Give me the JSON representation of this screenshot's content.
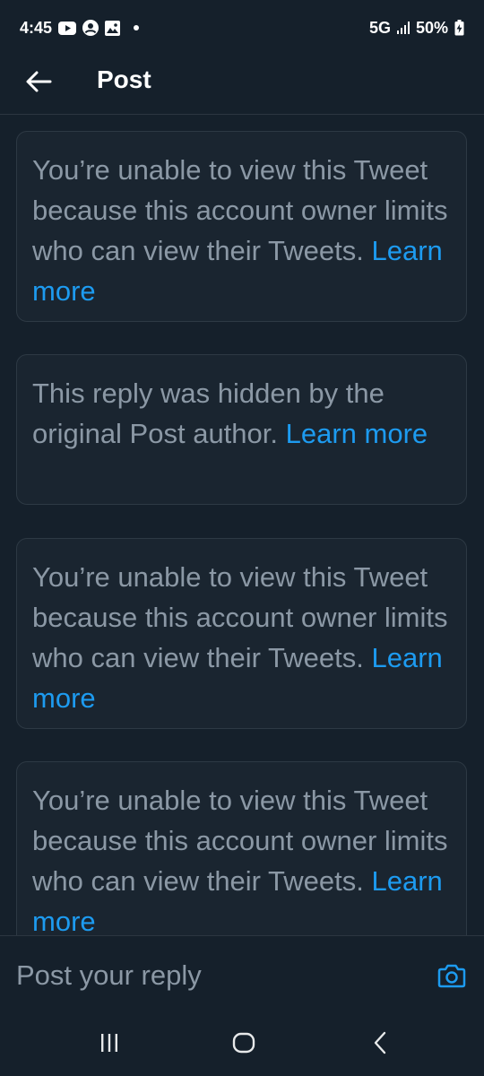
{
  "status_bar": {
    "time": "4:45",
    "network": "5G",
    "battery": "50%",
    "icons": [
      "youtube-icon",
      "account-circle-icon",
      "gallery-icon",
      "notification-dot-icon",
      "signal-icon",
      "battery-charging-icon"
    ]
  },
  "header": {
    "title": "Post",
    "back_icon": "arrow-left-icon"
  },
  "notices": [
    {
      "text": "You’re unable to view this Tweet because this account owner limits who can view their Tweets.",
      "link": "Learn more"
    },
    {
      "text": "This reply was hidden by the original Post author.",
      "link": "Learn more"
    },
    {
      "text": "You’re unable to view this Tweet because this account owner limits who can view their Tweets.",
      "link": "Learn more"
    },
    {
      "text": "You’re unable to view this Tweet because this account owner limits who can view their Tweets.",
      "link": "Learn more"
    }
  ],
  "reply": {
    "placeholder": "Post your reply",
    "value": "",
    "camera_icon": "camera-icon"
  },
  "nav": {
    "icons": [
      "recent-apps-icon",
      "home-icon",
      "back-icon"
    ]
  },
  "colors": {
    "background": "#15202b",
    "card": "#1a2530",
    "muted_text": "#8b98a5",
    "link": "#1d9bf0"
  }
}
